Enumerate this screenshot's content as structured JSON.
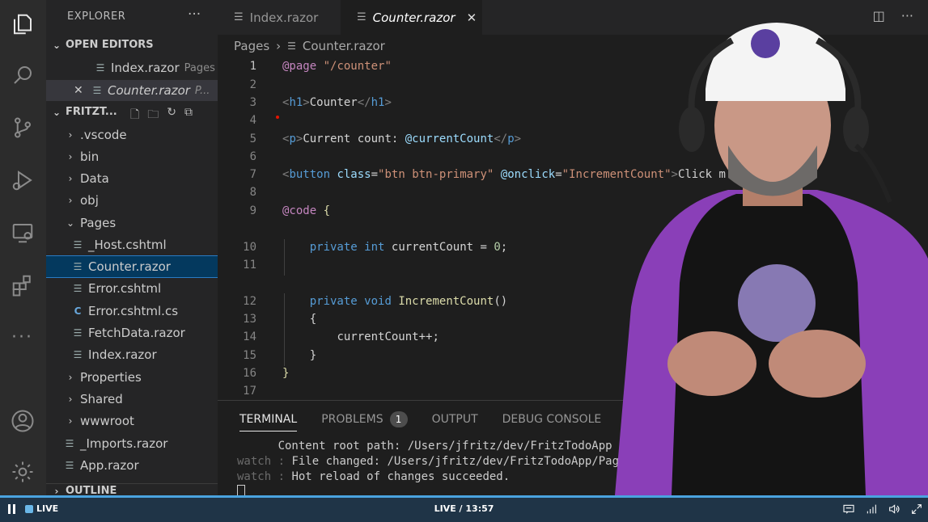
{
  "sidebar": {
    "title": "EXPLORER",
    "more": "···",
    "open_editors": {
      "label": "OPEN EDITORS",
      "items": [
        {
          "name": "Index.razor",
          "folder": "Pages"
        },
        {
          "name": "Counter.razor",
          "folder": "P..."
        }
      ]
    },
    "project": {
      "label": "FRITZT...",
      "items": [
        {
          "label": ".vscode"
        },
        {
          "label": "bin"
        },
        {
          "label": "Data"
        },
        {
          "label": "obj"
        },
        {
          "label": "Pages"
        },
        {
          "label": "_Host.cshtml"
        },
        {
          "label": "Counter.razor"
        },
        {
          "label": "Error.cshtml"
        },
        {
          "label": "Error.cshtml.cs"
        },
        {
          "label": "FetchData.razor"
        },
        {
          "label": "Index.razor"
        },
        {
          "label": "Properties"
        },
        {
          "label": "Shared"
        },
        {
          "label": "wwwroot"
        },
        {
          "label": "_Imports.razor"
        },
        {
          "label": "App.razor"
        }
      ]
    },
    "outline": "OUTLINE"
  },
  "tabs": [
    {
      "label": "Index.razor"
    },
    {
      "label": "Counter.razor"
    }
  ],
  "breadcrumb": {
    "part1": "Pages",
    "part2": "Counter.razor"
  },
  "editor": {
    "line_numbers": [
      "1",
      "2",
      "3",
      "4",
      "5",
      "6",
      "7",
      "8",
      "9",
      "10",
      "11",
      "12",
      "13",
      "14",
      "15",
      "16",
      "17"
    ],
    "code": {
      "l1_dir": "@page",
      "l1_str": "\"/counter\"",
      "l3_text": "Counter",
      "l5_text": "Current count: ",
      "l5_var": "@currentCount",
      "l7_attr1": "class",
      "l7_val1": "\"btn btn-primary\"",
      "l7_attr2": "@onclick",
      "l7_val2": "\"IncrementCount\"",
      "l7_text": "Click m",
      "l9_dir": "@code",
      "l10_text": "currentCount = ",
      "l10_num": "0",
      "l12_fn": "IncrementCount",
      "l14_text": "currentCount++;"
    }
  },
  "panel": {
    "tabs": [
      {
        "label": "TERMINAL"
      },
      {
        "label": "PROBLEMS",
        "badge": "1"
      },
      {
        "label": "OUTPUT"
      },
      {
        "label": "DEBUG CONSOLE"
      }
    ],
    "terminal_lines": [
      {
        "prefix": "",
        "text": "      Content root path: /Users/jfritz/dev/FritzTodoApp"
      },
      {
        "prefix": "watch : ",
        "text": "File changed: /Users/jfritz/dev/FritzTodoApp/Pages/Index"
      },
      {
        "prefix": "watch : ",
        "text": "Hot reload of changes succeeded."
      }
    ]
  },
  "player": {
    "live_label": "LIVE",
    "time": "LIVE / 13:57",
    "progress": 1.0
  }
}
